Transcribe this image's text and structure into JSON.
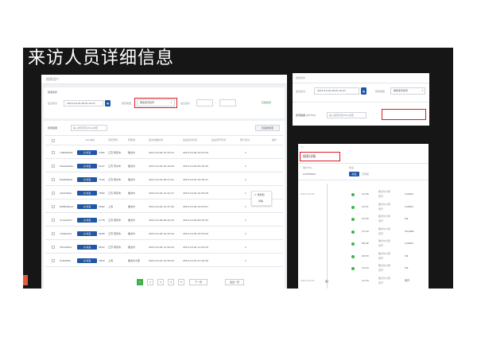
{
  "slide_title": "来访人员详细信息",
  "list_panel": {
    "header": "搜索用户",
    "filter_title": "搜索条件",
    "time_label": "最近来访",
    "date_range": "2015-10-01-2015-10-07",
    "type_label": "搜索类型",
    "type_value": "按搜索手机号",
    "freq_label": "最近来访",
    "range_sep": "~",
    "search_btn": "查",
    "advanced_link": "高级搜索",
    "result_title": "搜索结果",
    "search_placeholder": "输入搜索手机/Mac搜索",
    "export_btn": "筛选搜索项",
    "columns": [
      "Mac地址",
      "手机号码",
      "所属地",
      "首次接触时间",
      "最后来访时间",
      "最后离开时间",
      "累计来访",
      "操作"
    ],
    "rows": [
      {
        "mac": "14f6da0d8",
        "btn": "标签",
        "phone": "1382",
        "area": "江苏 南京市",
        "first": "雅戈尔",
        "last": "2015-10-06 12:24:31",
        "leave": "2015-10-06 14:23:39",
        "count": "1"
      },
      {
        "mac": "50eeaa60b",
        "btn": "标签",
        "phone": "0127",
        "area": "江苏 苏州市",
        "first": "雅戈尔",
        "last": "2015-10-04 16:19:09",
        "leave": "2015-10-04 09:39:45",
        "count": "1"
      },
      {
        "mac": "84e6f26e9",
        "btn": "标签",
        "phone": "7160",
        "area": "江苏 扬州市",
        "first": "雅戈尔",
        "last": "2015-10-03 08:21:41",
        "leave": "2015-10-03 10:36:21",
        "count": "1"
      },
      {
        "mac": "4e4218eb",
        "btn": "标签",
        "phone": "7880",
        "area": "江苏 南京市",
        "first": "雅戈尔",
        "last": "2015-10-04 12:22:47",
        "leave": "2015-10-04 10:35:28",
        "count": "1"
      },
      {
        "mac": "8086d4ba3",
        "btn": "标签",
        "phone": "0962",
        "area": "上海",
        "first": "雅戈尔",
        "last": "2015-10-04 12:37:45",
        "leave": "2015-10-04 14:53:07",
        "count": "1"
      },
      {
        "mac": "3c1ab4f17",
        "btn": "标签",
        "phone": "2778",
        "area": "江苏 南京市",
        "first": "雅戈尔",
        "last": "2015-10-06 08:20:30",
        "leave": "2015-10-06 09:25:30",
        "count": "1"
      },
      {
        "mac": "1d9b4a22",
        "btn": "标签",
        "phone": "9008",
        "area": "江苏 南京市",
        "first": "雅戈尔",
        "last": "2015-10-05 10:32:32",
        "leave": "2015-10-05 15:53:20",
        "count": "1"
      },
      {
        "mac": "3519d4ba",
        "btn": "标签",
        "phone": "0622",
        "area": "江苏 南京市",
        "first": "雅戈尔",
        "last": "2015-10-04 11:44:20",
        "leave": "2015-10-04 11:44:20",
        "count": "1"
      },
      {
        "mac": "0c4b0f0a",
        "btn": "标签",
        "phone": "7816",
        "area": "上海",
        "first": "雅戈尔大厦",
        "last": "2015-10-03 13:29:20",
        "leave": "2015-10-03 21:32:30",
        "count": "1"
      }
    ],
    "menu_items": [
      "添加到",
      "详情"
    ],
    "pages": [
      "1",
      "2",
      "3",
      "4",
      "5"
    ],
    "next_btn": "下一页",
    "last_btn": "最后一页"
  },
  "filter_panel": {
    "title": "搜索条件",
    "time_label": "最近来访",
    "date_range": "2015-10-01-2015-10-07",
    "type_label": "搜索类型",
    "type_value": "按搜索手机号",
    "result_label": "搜索数据 (27774)",
    "search_placeholder": "输入搜索手机/Mac搜索"
  },
  "detail_panel": {
    "title": "搜索详情",
    "col_mac": "用户Mac",
    "col_tag": "标签",
    "mac": "ac3f7dbb9",
    "tags": [
      "标签",
      "已添加"
    ],
    "timeline": [
      {
        "date": "2015-10-12",
        "time": "13:04",
        "a": "雅戈尔大厦",
        "b": "离开",
        "c": "4.0000"
      },
      {
        "date": "",
        "time": "14:11",
        "a": "雅戈尔大厦",
        "b": "离开",
        "c": "4.0000"
      },
      {
        "date": "",
        "time": "15:33",
        "a": "雅戈尔大厦",
        "b": "离开",
        "c": "CN"
      },
      {
        "date": "",
        "time": "17:10",
        "a": "雅戈尔大厦",
        "b": "离开",
        "c": "TP-LINK"
      },
      {
        "date": "",
        "time": "08:42",
        "a": "雅戈尔大厦",
        "b": "离开",
        "c": "4.0000"
      },
      {
        "date": "",
        "time": "09:53",
        "a": "雅戈尔大厦",
        "b": "离开",
        "c": "CN"
      },
      {
        "date": "",
        "time": "10:14",
        "a": "雅戈尔大厦",
        "b": "离开",
        "c": "CN"
      },
      {
        "date": "2015-10-13",
        "time": "11:10",
        "a": "雅戈尔大厦",
        "b": "离开",
        "c": "离开"
      }
    ]
  }
}
